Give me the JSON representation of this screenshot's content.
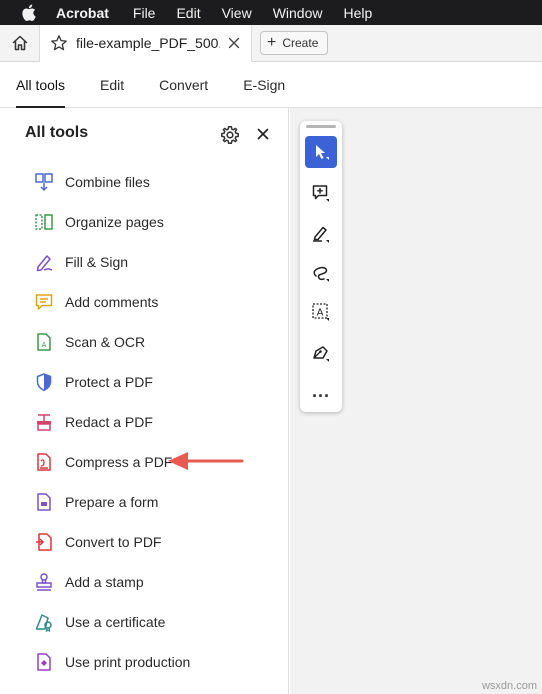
{
  "menubar": {
    "app_name": "Acrobat",
    "items": [
      "File",
      "Edit",
      "View",
      "Window",
      "Help"
    ]
  },
  "tabbar": {
    "doc_title": "file-example_PDF_500...",
    "create_label": "Create"
  },
  "nav": {
    "tabs": [
      {
        "label": "All tools",
        "active": true
      },
      {
        "label": "Edit",
        "active": false
      },
      {
        "label": "Convert",
        "active": false
      },
      {
        "label": "E-Sign",
        "active": false
      }
    ]
  },
  "panel": {
    "title": "All tools",
    "tools": [
      {
        "label": "Combine files",
        "icon": "combine-files-icon",
        "color": "#4a6ad0"
      },
      {
        "label": "Organize pages",
        "icon": "organize-pages-icon",
        "color": "#3a9b4a"
      },
      {
        "label": "Fill & Sign",
        "icon": "fill-sign-icon",
        "color": "#7b52c7"
      },
      {
        "label": "Add comments",
        "icon": "add-comments-icon",
        "color": "#e0a21c"
      },
      {
        "label": "Scan & OCR",
        "icon": "scan-ocr-icon",
        "color": "#3a9b4a"
      },
      {
        "label": "Protect a PDF",
        "icon": "protect-pdf-icon",
        "color": "#4a6ad0"
      },
      {
        "label": "Redact a PDF",
        "icon": "redact-pdf-icon",
        "color": "#d2436b"
      },
      {
        "label": "Compress a PDF",
        "icon": "compress-pdf-icon",
        "color": "#d8373a"
      },
      {
        "label": "Prepare a form",
        "icon": "prepare-form-icon",
        "color": "#7b52c7"
      },
      {
        "label": "Convert to PDF",
        "icon": "convert-pdf-icon",
        "color": "#d8373a"
      },
      {
        "label": "Add a stamp",
        "icon": "stamp-icon",
        "color": "#7b52c7"
      },
      {
        "label": "Use a certificate",
        "icon": "certificate-icon",
        "color": "#2f8a8a"
      },
      {
        "label": "Use print production",
        "icon": "print-production-icon",
        "color": "#9a3fc2"
      }
    ]
  },
  "annotation": {
    "color": "#e65a4f",
    "target": "Compress a PDF"
  },
  "quick_tools": {
    "accent": "#3b63d6",
    "items": [
      "select-cursor-icon",
      "add-comment-icon",
      "highlight-pen-icon",
      "draw-freehand-icon",
      "text-box-icon",
      "sign-icon"
    ],
    "more": "..."
  },
  "watermark": "wsxdn.com"
}
